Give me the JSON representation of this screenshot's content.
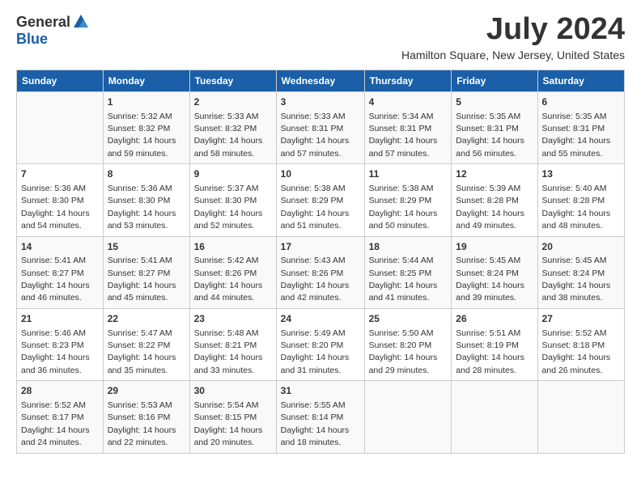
{
  "logo": {
    "general": "General",
    "blue": "Blue"
  },
  "title": "July 2024",
  "subtitle": "Hamilton Square, New Jersey, United States",
  "days_header": [
    "Sunday",
    "Monday",
    "Tuesday",
    "Wednesday",
    "Thursday",
    "Friday",
    "Saturday"
  ],
  "weeks": [
    [
      {
        "day": "",
        "info": ""
      },
      {
        "day": "1",
        "info": "Sunrise: 5:32 AM\nSunset: 8:32 PM\nDaylight: 14 hours and 59 minutes."
      },
      {
        "day": "2",
        "info": "Sunrise: 5:33 AM\nSunset: 8:32 PM\nDaylight: 14 hours and 58 minutes."
      },
      {
        "day": "3",
        "info": "Sunrise: 5:33 AM\nSunset: 8:31 PM\nDaylight: 14 hours and 57 minutes."
      },
      {
        "day": "4",
        "info": "Sunrise: 5:34 AM\nSunset: 8:31 PM\nDaylight: 14 hours and 57 minutes."
      },
      {
        "day": "5",
        "info": "Sunrise: 5:35 AM\nSunset: 8:31 PM\nDaylight: 14 hours and 56 minutes."
      },
      {
        "day": "6",
        "info": "Sunrise: 5:35 AM\nSunset: 8:31 PM\nDaylight: 14 hours and 55 minutes."
      }
    ],
    [
      {
        "day": "7",
        "info": "Sunrise: 5:36 AM\nSunset: 8:30 PM\nDaylight: 14 hours and 54 minutes."
      },
      {
        "day": "8",
        "info": "Sunrise: 5:36 AM\nSunset: 8:30 PM\nDaylight: 14 hours and 53 minutes."
      },
      {
        "day": "9",
        "info": "Sunrise: 5:37 AM\nSunset: 8:30 PM\nDaylight: 14 hours and 52 minutes."
      },
      {
        "day": "10",
        "info": "Sunrise: 5:38 AM\nSunset: 8:29 PM\nDaylight: 14 hours and 51 minutes."
      },
      {
        "day": "11",
        "info": "Sunrise: 5:38 AM\nSunset: 8:29 PM\nDaylight: 14 hours and 50 minutes."
      },
      {
        "day": "12",
        "info": "Sunrise: 5:39 AM\nSunset: 8:28 PM\nDaylight: 14 hours and 49 minutes."
      },
      {
        "day": "13",
        "info": "Sunrise: 5:40 AM\nSunset: 8:28 PM\nDaylight: 14 hours and 48 minutes."
      }
    ],
    [
      {
        "day": "14",
        "info": "Sunrise: 5:41 AM\nSunset: 8:27 PM\nDaylight: 14 hours and 46 minutes."
      },
      {
        "day": "15",
        "info": "Sunrise: 5:41 AM\nSunset: 8:27 PM\nDaylight: 14 hours and 45 minutes."
      },
      {
        "day": "16",
        "info": "Sunrise: 5:42 AM\nSunset: 8:26 PM\nDaylight: 14 hours and 44 minutes."
      },
      {
        "day": "17",
        "info": "Sunrise: 5:43 AM\nSunset: 8:26 PM\nDaylight: 14 hours and 42 minutes."
      },
      {
        "day": "18",
        "info": "Sunrise: 5:44 AM\nSunset: 8:25 PM\nDaylight: 14 hours and 41 minutes."
      },
      {
        "day": "19",
        "info": "Sunrise: 5:45 AM\nSunset: 8:24 PM\nDaylight: 14 hours and 39 minutes."
      },
      {
        "day": "20",
        "info": "Sunrise: 5:45 AM\nSunset: 8:24 PM\nDaylight: 14 hours and 38 minutes."
      }
    ],
    [
      {
        "day": "21",
        "info": "Sunrise: 5:46 AM\nSunset: 8:23 PM\nDaylight: 14 hours and 36 minutes."
      },
      {
        "day": "22",
        "info": "Sunrise: 5:47 AM\nSunset: 8:22 PM\nDaylight: 14 hours and 35 minutes."
      },
      {
        "day": "23",
        "info": "Sunrise: 5:48 AM\nSunset: 8:21 PM\nDaylight: 14 hours and 33 minutes."
      },
      {
        "day": "24",
        "info": "Sunrise: 5:49 AM\nSunset: 8:20 PM\nDaylight: 14 hours and 31 minutes."
      },
      {
        "day": "25",
        "info": "Sunrise: 5:50 AM\nSunset: 8:20 PM\nDaylight: 14 hours and 29 minutes."
      },
      {
        "day": "26",
        "info": "Sunrise: 5:51 AM\nSunset: 8:19 PM\nDaylight: 14 hours and 28 minutes."
      },
      {
        "day": "27",
        "info": "Sunrise: 5:52 AM\nSunset: 8:18 PM\nDaylight: 14 hours and 26 minutes."
      }
    ],
    [
      {
        "day": "28",
        "info": "Sunrise: 5:52 AM\nSunset: 8:17 PM\nDaylight: 14 hours and 24 minutes."
      },
      {
        "day": "29",
        "info": "Sunrise: 5:53 AM\nSunset: 8:16 PM\nDaylight: 14 hours and 22 minutes."
      },
      {
        "day": "30",
        "info": "Sunrise: 5:54 AM\nSunset: 8:15 PM\nDaylight: 14 hours and 20 minutes."
      },
      {
        "day": "31",
        "info": "Sunrise: 5:55 AM\nSunset: 8:14 PM\nDaylight: 14 hours and 18 minutes."
      },
      {
        "day": "",
        "info": ""
      },
      {
        "day": "",
        "info": ""
      },
      {
        "day": "",
        "info": ""
      }
    ]
  ]
}
